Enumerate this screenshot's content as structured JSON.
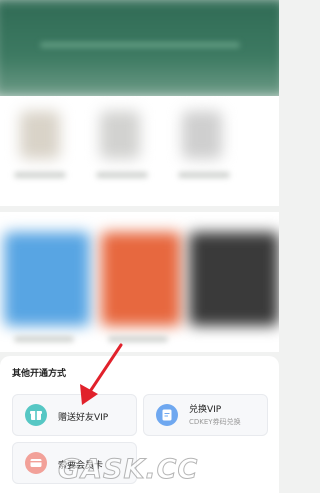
{
  "section_title": "其他开通方式",
  "options": [
    {
      "title": "赠送好友VIP",
      "subtitle": "",
      "icon": "gift-icon",
      "color": "#56c7c4"
    },
    {
      "title": "兑换VIP",
      "subtitle": "CDKEY券码兑换",
      "icon": "coupon-icon",
      "color": "#6fa8f0"
    },
    {
      "title": "索要会员卡",
      "subtitle": "",
      "icon": "card-icon",
      "color": "#f2a199"
    }
  ],
  "watermark": "GASK.CC",
  "colors": {
    "accent_arrow": "#e1212b",
    "banner": "#2f6a54"
  }
}
